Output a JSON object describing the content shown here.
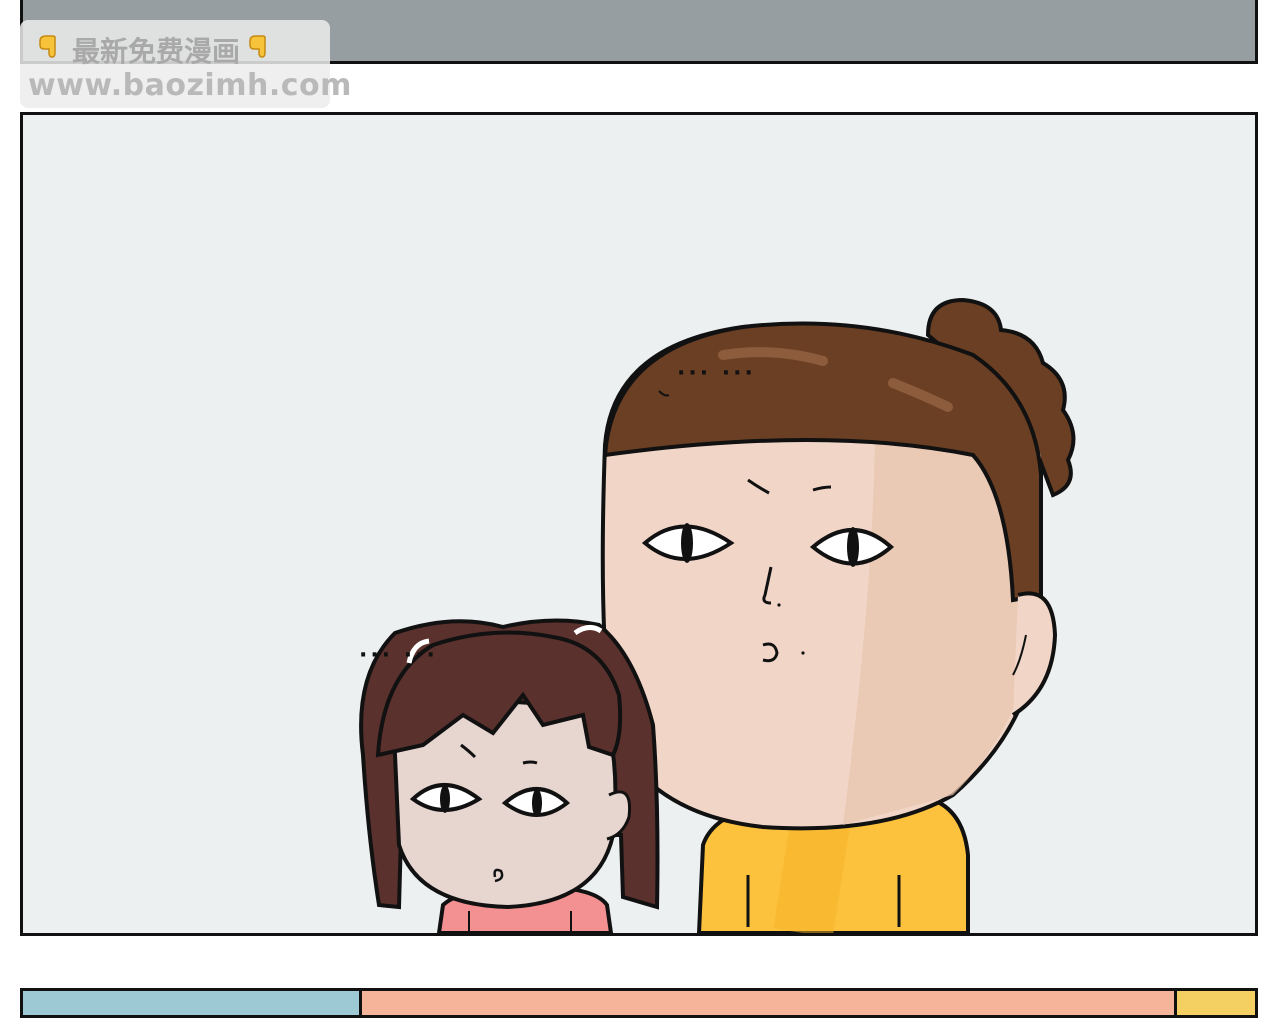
{
  "watermark": {
    "line1": "最新免费漫画",
    "line2": "www.baozimh.com",
    "icon": "pointing-down-hand-icon"
  },
  "dialogue": {
    "left_ellipsis": "··· ···",
    "right_ellipsis": "··· ···"
  },
  "colors": {
    "background": "#ecf0f1",
    "hair_brown": "#6b3f24",
    "skin": "#f1d6c8",
    "shirt_yellow": "#fcc23d",
    "shirt_pink": "#f29092",
    "girl_hair": "#5a312c"
  }
}
